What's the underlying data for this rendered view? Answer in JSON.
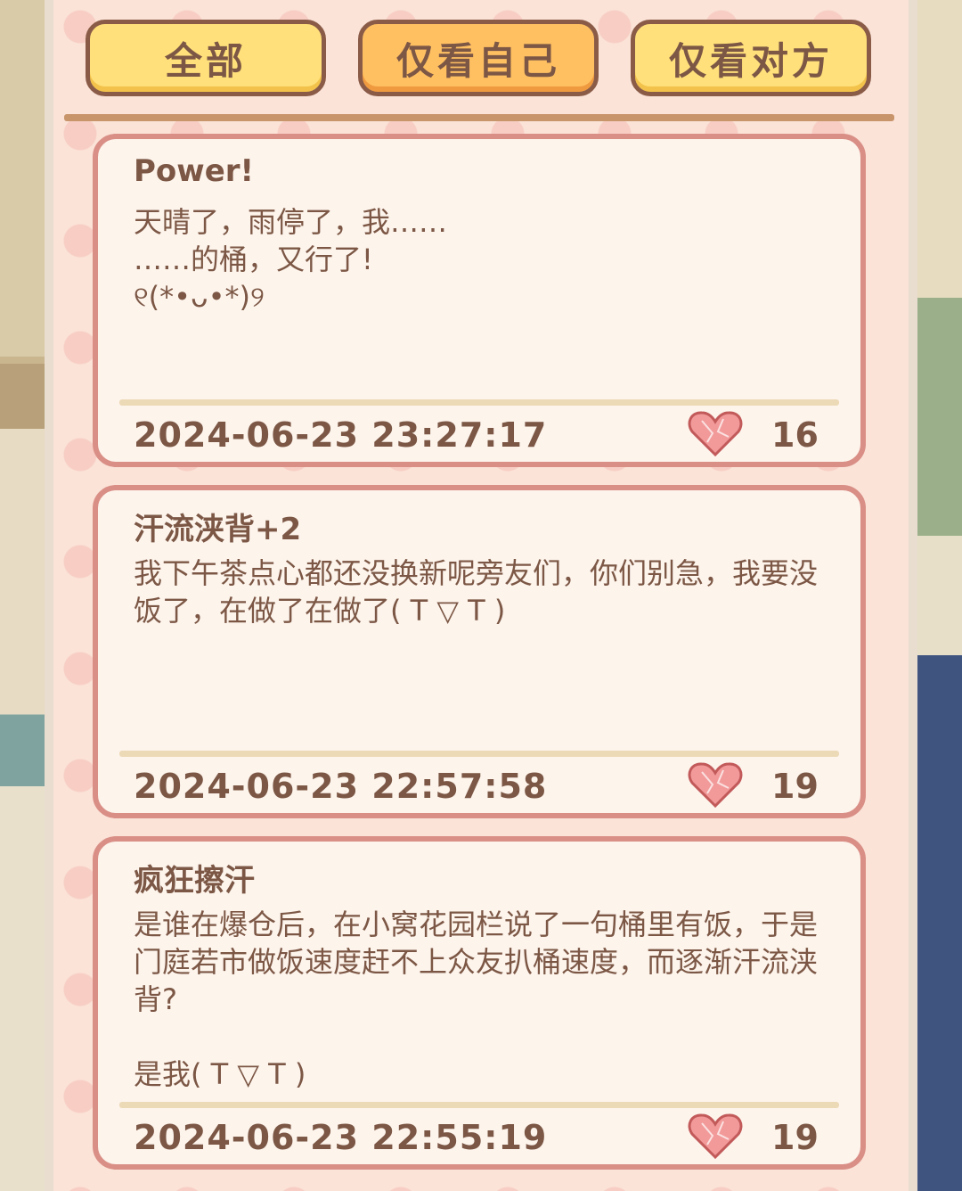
{
  "tabs": [
    {
      "label": "全部"
    },
    {
      "label": "仅看自己"
    },
    {
      "label": "仅看对方"
    }
  ],
  "active_tab": 1,
  "posts": [
    {
      "title": "Power!",
      "body": "天晴了，雨停了，我……\n……的桶，又行了!\n୧(*•ᴗ•*)୨",
      "time": "2024-06-23 23:27:17",
      "likes": "16"
    },
    {
      "title": "汗流浃背+2",
      "body": "我下午茶点心都还没换新呢旁友们，你们别急，我要没饭了，在做了在做了( T ▽ T )",
      "time": "2024-06-23 22:57:58",
      "likes": "19"
    },
    {
      "title": "疯狂擦汗",
      "body": "是谁在爆仓后，在小窝花园栏说了一句桶里有饭，于是门庭若市做饭速度赶不上众友扒桶速度，而逐渐汗流浃背?\n\n是我( T ▽ T )",
      "time": "2024-06-23 22:55:19",
      "likes": "19"
    }
  ],
  "colors": {
    "accent": "#d98f86",
    "text": "#7c5745",
    "tab": "#ffe07a",
    "tab_active": "#ffc062"
  }
}
